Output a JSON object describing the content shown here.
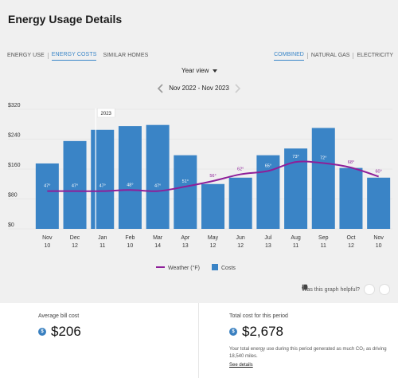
{
  "page": {
    "title": "Energy Usage Details"
  },
  "tabs_left": [
    "ENERGY USE",
    "ENERGY COSTS",
    "SIMILAR HOMES"
  ],
  "tabs_right": [
    "COMBINED",
    "NATURAL GAS",
    "ELECTRICITY"
  ],
  "view_selector": {
    "label": "Year view"
  },
  "date_range": {
    "label": "Nov 2022 - Nov 2023"
  },
  "colors": {
    "bar": "#3a84c6",
    "weather": "#8e1f99",
    "background": "#f0f0f0",
    "accent": "#3a86c8"
  },
  "icons": {
    "prev": "chevron-left-icon",
    "next": "chevron-right-icon",
    "dropdown": "caret-down-icon",
    "thumbs_up": "thumbs-up-icon",
    "thumbs_down": "thumbs-down-icon",
    "dollar": "dollar-circle-icon"
  },
  "chart_data": {
    "type": "bar",
    "year_marker": "2023",
    "year_marker_index": 3,
    "categories": [
      [
        "Nov",
        "10"
      ],
      [
        "Dec",
        "12"
      ],
      [
        "Jan",
        "11"
      ],
      [
        "Feb",
        "10"
      ],
      [
        "Mar",
        "14"
      ],
      [
        "Apr",
        "13"
      ],
      [
        "May",
        "12"
      ],
      [
        "Jun",
        "12"
      ],
      [
        "Jul",
        "13"
      ],
      [
        "Aug",
        "11"
      ],
      [
        "Sep",
        "11"
      ],
      [
        "Oct",
        "12"
      ],
      [
        "Nov",
        "10"
      ]
    ],
    "ylim": [
      0,
      320
    ],
    "yticks": [
      0,
      80,
      160,
      240,
      320
    ],
    "ytick_labels": [
      "$0",
      "$80",
      "$160",
      "$240",
      "$320"
    ],
    "series": [
      {
        "name": "Costs",
        "kind": "bar",
        "values": [
          175,
          235,
          265,
          275,
          278,
          197,
          120,
          137,
          197,
          215,
          270,
          163,
          137
        ]
      },
      {
        "name": "Weather (°F)",
        "kind": "line",
        "values": [
          47,
          47,
          47,
          48,
          47,
          51,
          56,
          62,
          65,
          73,
          72,
          68,
          60
        ],
        "labels": [
          "47°",
          "47°",
          "47°",
          "48°",
          "47°",
          "51°",
          "56°",
          "62°",
          "65°",
          "73°",
          "72°",
          "68°",
          "60°"
        ]
      }
    ],
    "legend": [
      "Weather (°F)",
      "Costs"
    ]
  },
  "feedback": {
    "question": "Was this graph helpful?"
  },
  "summary": {
    "avg_label": "Average bill cost",
    "avg_value": "$206",
    "total_label": "Total cost for this period",
    "total_value": "$2,678",
    "note": "Your total energy use during this period generated as much CO₂ as driving 18,540 miles.",
    "link": "See details"
  }
}
